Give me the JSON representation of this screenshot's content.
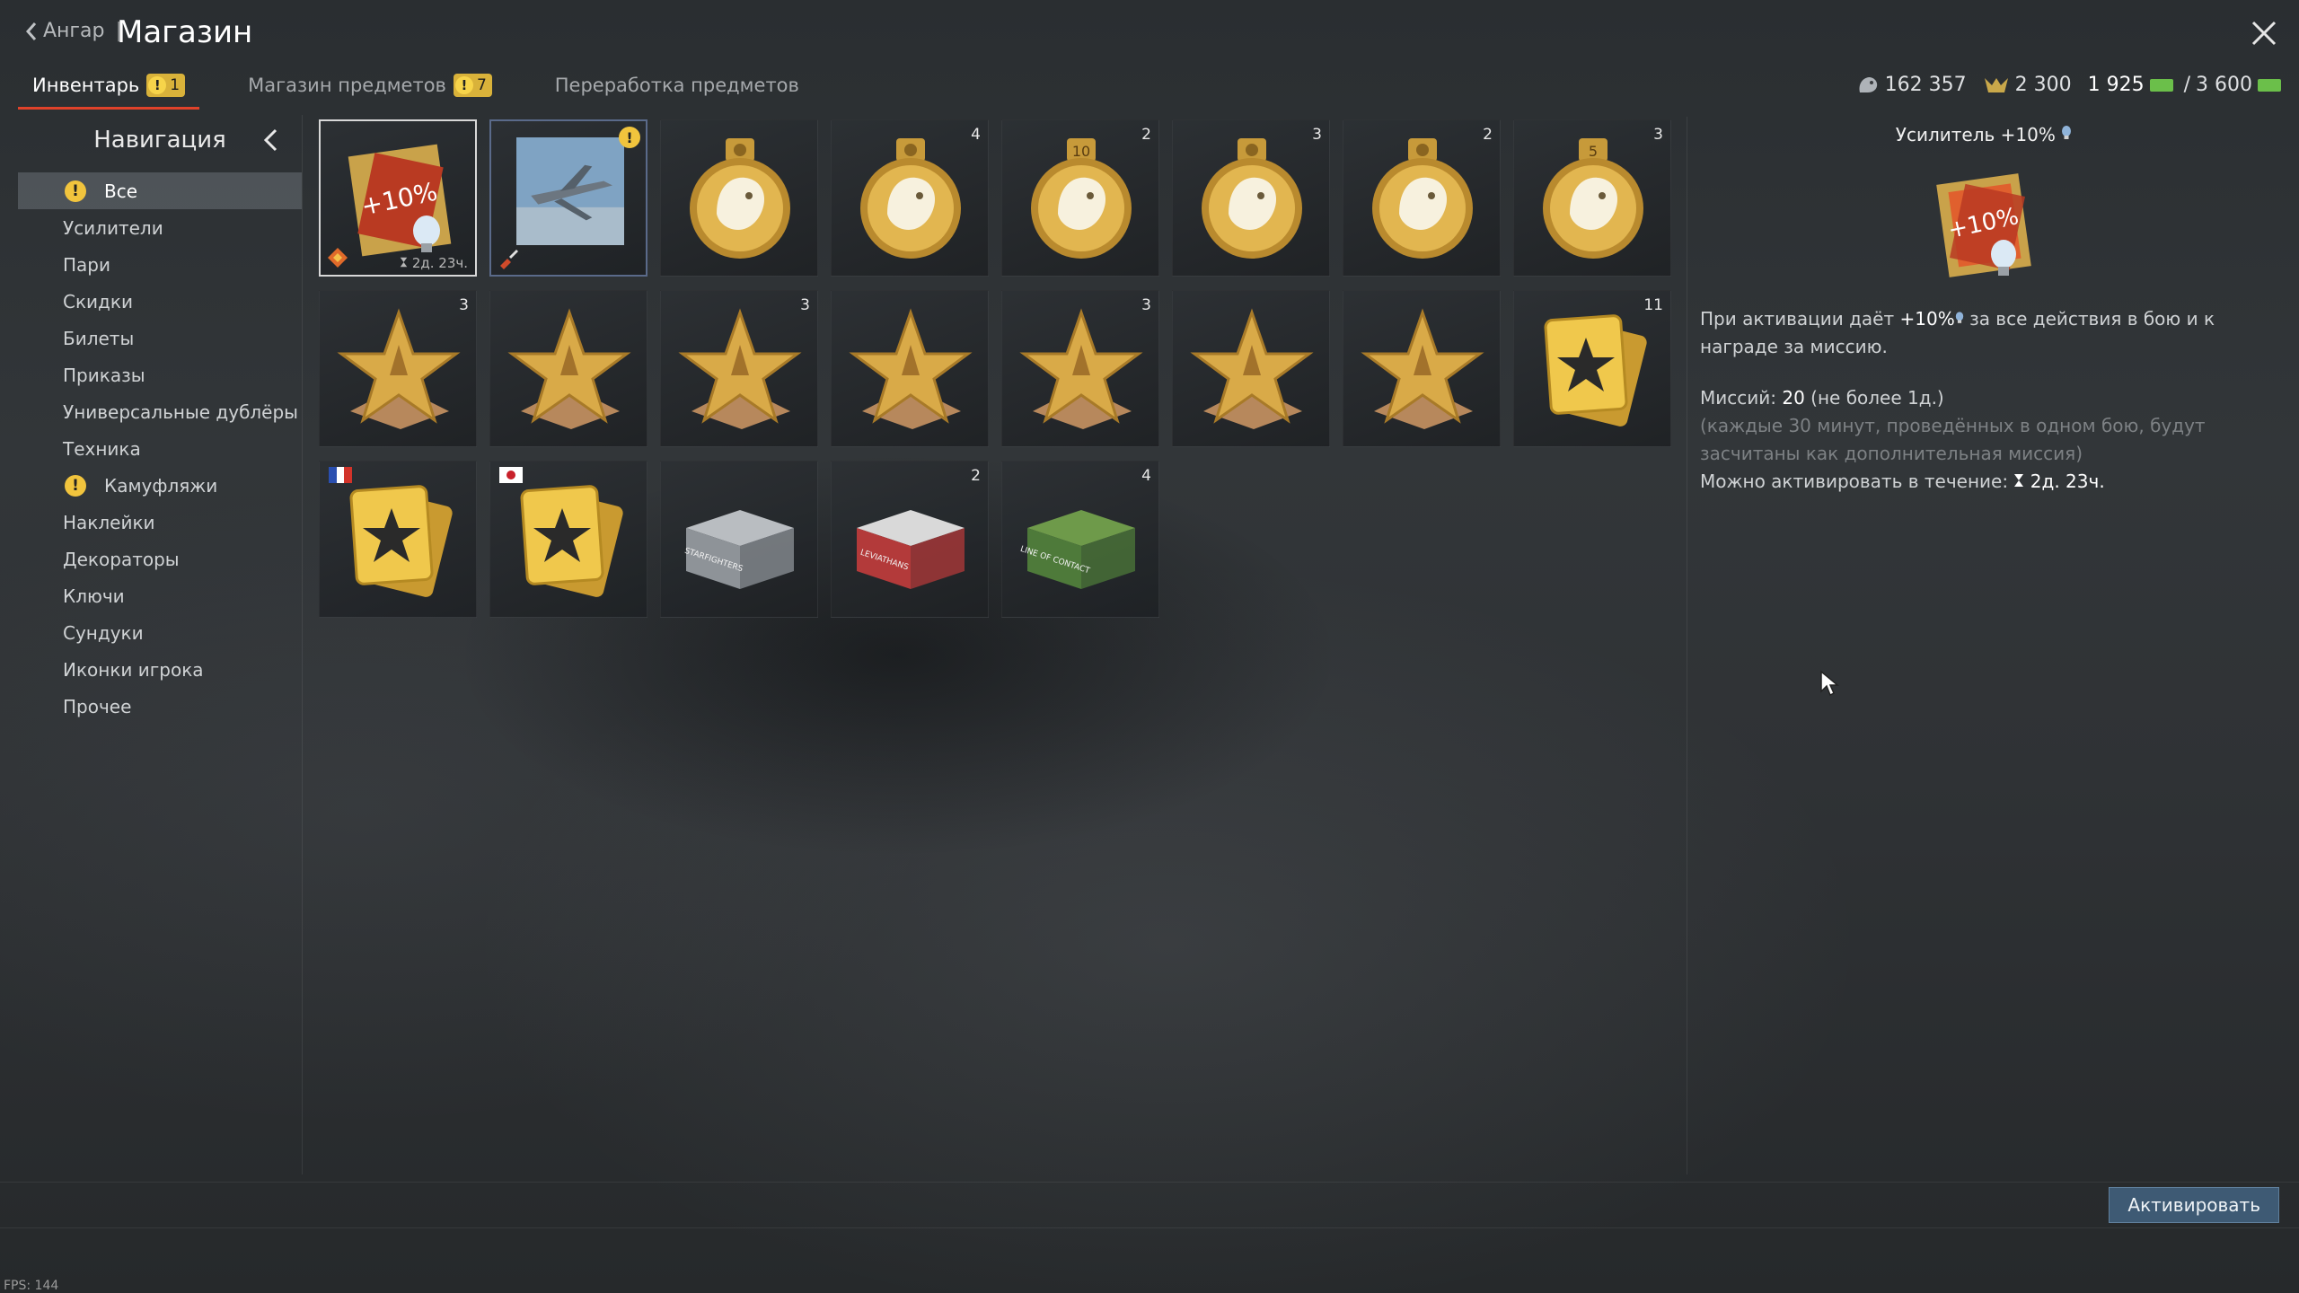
{
  "header": {
    "back_label": "Ангар",
    "separator": "|",
    "title": "Магазин"
  },
  "tabs": [
    {
      "label": "Инвентарь",
      "badge": "1",
      "active": true
    },
    {
      "label": "Магазин предметов",
      "badge": "7",
      "active": false
    },
    {
      "label": "Переработка предметов",
      "badge": "",
      "active": false
    }
  ],
  "currencies": {
    "silver_lions": "162 357",
    "eagles": "2 300",
    "cash_current": "1 925",
    "cash_separator": "/",
    "cash_max": "3 600"
  },
  "sidebar": {
    "title": "Навигация",
    "items": [
      {
        "label": "Все",
        "warn": true,
        "selected": true
      },
      {
        "label": "Усилители",
        "warn": false
      },
      {
        "label": "Пари",
        "warn": false
      },
      {
        "label": "Скидки",
        "warn": false
      },
      {
        "label": "Билеты",
        "warn": false
      },
      {
        "label": "Приказы",
        "warn": false
      },
      {
        "label": "Универсальные дублёры",
        "warn": false
      },
      {
        "label": "Техника",
        "warn": false
      },
      {
        "label": "Камуфляжи",
        "warn": true
      },
      {
        "label": "Наклейки",
        "warn": false
      },
      {
        "label": "Декораторы",
        "warn": false
      },
      {
        "label": "Ключи",
        "warn": false
      },
      {
        "label": "Сундуки",
        "warn": false
      },
      {
        "label": "Иконки игрока",
        "warn": false
      },
      {
        "label": "Прочее",
        "warn": false
      }
    ]
  },
  "inventory": [
    {
      "name": "booster-10",
      "count": "",
      "timer": "2д. 23ч.",
      "selected": true
    },
    {
      "name": "camo-jet",
      "count": "",
      "alert": "!"
    },
    {
      "name": "medal-1",
      "count": ""
    },
    {
      "name": "medal-2",
      "count": "4"
    },
    {
      "name": "medal-10",
      "count": "2",
      "medal_text": "10"
    },
    {
      "name": "medal-star",
      "count": "3"
    },
    {
      "name": "medal-pick",
      "count": "2"
    },
    {
      "name": "medal-5",
      "count": "3",
      "medal_text": "5"
    },
    {
      "name": "order-1",
      "count": "3"
    },
    {
      "name": "order-2",
      "count": ""
    },
    {
      "name": "order-3",
      "count": "3"
    },
    {
      "name": "order-4",
      "count": ""
    },
    {
      "name": "order-5",
      "count": "3"
    },
    {
      "name": "order-6",
      "count": ""
    },
    {
      "name": "order-7",
      "count": ""
    },
    {
      "name": "crew-card",
      "count": "11"
    },
    {
      "name": "crew-card-fr",
      "count": "",
      "flag": "fr"
    },
    {
      "name": "crew-card-jp",
      "count": "",
      "flag": "jp"
    },
    {
      "name": "chest-starfighters",
      "count": "",
      "chest_text": "STARFIGHTERS"
    },
    {
      "name": "chest-leviathans",
      "count": "2",
      "chest_text": "LEVIATHANS"
    },
    {
      "name": "chest-line-of-contact",
      "count": "4",
      "chest_text": "LINE OF CONTACT"
    }
  ],
  "detail": {
    "title": "Усилитель +10%",
    "line1_prefix": "При активации даёт",
    "line1_value": "+10%",
    "line1_suffix": "за все действия в бою и к награде за миссию.",
    "missions_label": "Миссий:",
    "missions_value": "20",
    "missions_note": "(не более 1д.)",
    "hint": "(каждые 30 минут, проведённых в одном бою, будут засчитаны как дополнительная миссия)",
    "activate_label": "Можно активировать в течение:",
    "activate_time": "2д. 23ч."
  },
  "buttons": {
    "activate": "Активировать"
  },
  "fps": "FPS: 144",
  "colors": {
    "accent_red": "#e0422a",
    "badge_gold": "#d9b23a",
    "button_blue": "#3e5a74"
  }
}
